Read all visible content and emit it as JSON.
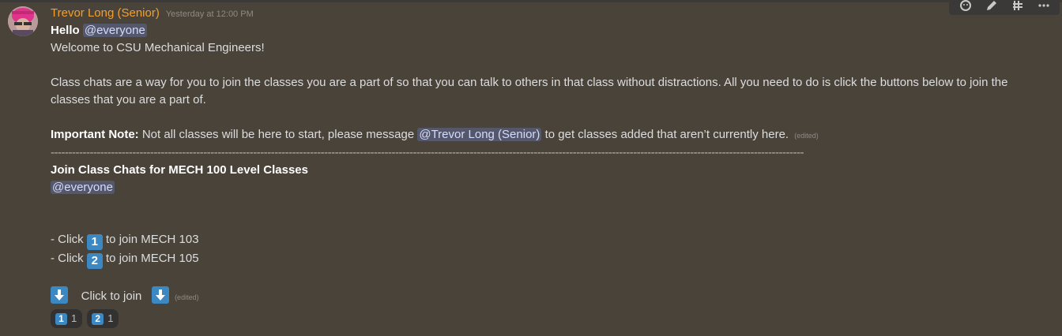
{
  "message": {
    "author": "Trevor Long (Senior)",
    "timestamp": "Yesterday at 12:00 PM",
    "greeting": "Hello",
    "everyone_mention": "@everyone",
    "welcome": "Welcome to CSU Mechanical Engineers!",
    "class_chats_text": "Class chats are a way for you to join the classes you are a part of so that you can talk to others in that class without distractions. All you need to do is click the buttons below to join the classes that you are a part of.",
    "important_label": "Important Note:",
    "important_text_1": "Not all classes will be here to start, please message",
    "author_mention": "@Trevor Long (Senior)",
    "important_text_2": "to get classes added that aren’t currently here.",
    "edited": "(edited)",
    "divider": "--------------------------------------------------------------------------------------------------------------------------------------------------------------------------------------------------------------------",
    "section_title": "Join Class Chats for MECH 100 Level Classes",
    "section_mention": "@everyone",
    "items": [
      {
        "prefix": "- Click",
        "key": "1",
        "suffix": "to join MECH 103"
      },
      {
        "prefix": "- Click",
        "key": "2",
        "suffix": "to join MECH 105"
      }
    ],
    "click_to_join": "Click to join",
    "edited_2": "(edited)"
  },
  "reactions": [
    {
      "emoji": "1",
      "count": "1"
    },
    {
      "emoji": "2",
      "count": "1"
    }
  ],
  "toolbar": {
    "icons": [
      "add-reaction-icon",
      "edit-icon",
      "thread-icon",
      "more-icon"
    ]
  },
  "colors": {
    "background": "#4a433a",
    "author": "#f0a030",
    "keycap": "#3b88c3",
    "mention_bg": "rgba(114,137,218,0.30)"
  }
}
